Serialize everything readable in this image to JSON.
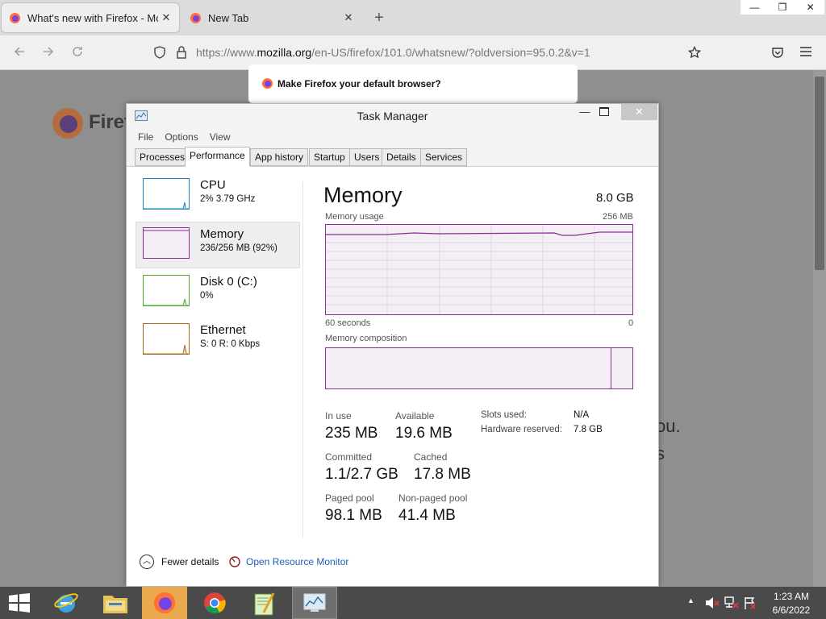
{
  "browser": {
    "tabs": [
      {
        "title": "What's new with Firefox - More"
      },
      {
        "title": "New Tab"
      }
    ],
    "new_tab_symbol": "+",
    "tab_close_symbol": "✕",
    "window_controls": {
      "minimize": "—",
      "restore": "❐",
      "close": "✕"
    },
    "url": {
      "prefix": "https://www.",
      "domain": "mozilla.org",
      "path": "/en-US/firefox/101.0/whatsnew/?oldversion=95.0.2&v=1"
    },
    "page": {
      "logo_text": "Firef",
      "fragment_1": "ou.",
      "fragment_2": "s"
    },
    "default_browser_prompt": "Make Firefox your default browser?"
  },
  "task_manager": {
    "title": "Task Manager",
    "window_controls": {
      "minimize": "—",
      "close": "✕"
    },
    "menu": [
      "File",
      "Options",
      "View"
    ],
    "tabs": [
      "Processes",
      "Performance",
      "App history",
      "Startup",
      "Users",
      "Details",
      "Services"
    ],
    "active_tab": "Performance",
    "resources": [
      {
        "name": "CPU",
        "value": "2%  3.79 GHz",
        "color": "#1a86c8"
      },
      {
        "name": "Memory",
        "value": "236/256 MB (92%)",
        "color": "#8b2c98"
      },
      {
        "name": "Disk 0 (C:)",
        "value": "0%",
        "color": "#4ea72e"
      },
      {
        "name": "Ethernet",
        "value": "S: 0  R: 0 Kbps",
        "color": "#a7651a"
      }
    ],
    "memory": {
      "heading": "Memory",
      "total": "8.0 GB",
      "usage_label": "Memory usage",
      "usage_max": "256 MB",
      "axis_left": "60 seconds",
      "axis_right": "0",
      "composition_label": "Memory composition",
      "stats": {
        "in_use": {
          "label": "In use",
          "value": "235 MB"
        },
        "available": {
          "label": "Available",
          "value": "19.6 MB"
        },
        "committed": {
          "label": "Committed",
          "value": "1.1/2.7 GB"
        },
        "cached": {
          "label": "Cached",
          "value": "17.8 MB"
        },
        "paged_pool": {
          "label": "Paged pool",
          "value": "98.1 MB"
        },
        "non_paged_pool": {
          "label": "Non-paged pool",
          "value": "41.4 MB"
        }
      },
      "side_stats": {
        "slots_used": {
          "label": "Slots used:",
          "value": "N/A"
        },
        "hardware_reserved": {
          "label": "Hardware reserved:",
          "value": "7.8 GB"
        }
      }
    },
    "footer": {
      "fewer_details": "Fewer details",
      "resource_monitor": "Open Resource Monitor"
    }
  },
  "taskbar": {
    "apps": [
      "start",
      "internet-explorer",
      "file-explorer",
      "firefox",
      "chrome",
      "notepad-plus-plus",
      "task-manager"
    ],
    "active_app": "firefox",
    "tray_arrow": "▲",
    "time": "1:23 AM",
    "date": "6/6/2022"
  }
}
